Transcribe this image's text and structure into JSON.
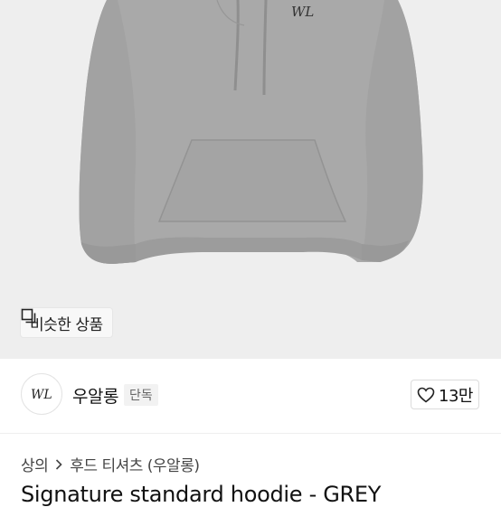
{
  "hero": {
    "similar_label": "비슷한 상품",
    "similar_icon": "copy-icon"
  },
  "store": {
    "name": "우알롱",
    "badge": "단독",
    "logo_text": "WL",
    "like_count": "13만",
    "like_icon": "heart-icon"
  },
  "breadcrumb": {
    "items": [
      "상의",
      "후드 티셔츠 (우알롱)"
    ],
    "separator_icon": "chevron-right-icon"
  },
  "product": {
    "title": "Signature standard hoodie - GREY"
  },
  "colors": {
    "hero_bg": "#eeeeee",
    "hoodie": "#a9a9a9"
  }
}
